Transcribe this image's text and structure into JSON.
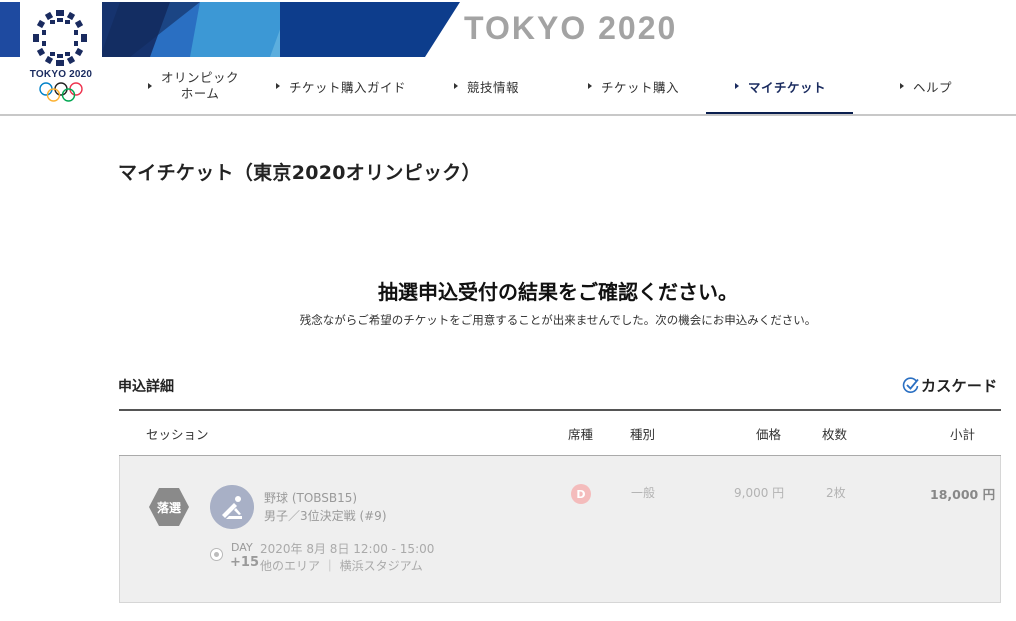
{
  "header": {
    "logo_text": "TOKYO 2020",
    "brand_text": "TOKYO 2020",
    "nav": [
      {
        "label_line1": "オリンピック",
        "label_line2": "ホーム"
      },
      {
        "label": "チケット購入ガイド"
      },
      {
        "label": "競技情報"
      },
      {
        "label": "チケット購入"
      },
      {
        "label": "マイチケット",
        "active": true
      },
      {
        "label": "ヘルプ"
      }
    ]
  },
  "page": {
    "title": "マイチケット（東京2020オリンピック）",
    "result_heading": "抽選申込受付の結果をご確認ください。",
    "result_sub": "残念ながらご希望のチケットをご用意することが出来ませんでした。次の機会にお申込みください。",
    "detail_label": "申込詳細",
    "cascade_label": "カスケード"
  },
  "table": {
    "headers": {
      "session": "セッション",
      "seat": "席種",
      "type": "種別",
      "price": "価格",
      "qty": "枚数",
      "subtotal": "小計"
    },
    "rows": [
      {
        "status": "落選",
        "event": "野球 (TOBSB15)",
        "event_sub": "男子／3位決定戦 (#9)",
        "day_label": "DAY",
        "day_num": "+15",
        "datetime": "2020年 8月 8日 12:00 - 15:00",
        "venue": "他のエリア ｜ 横浜スタジアム",
        "seat": "D",
        "type": "一般",
        "price": "9,000 円",
        "qty": "2枚",
        "subtotal": "18,000 円"
      }
    ]
  },
  "colors": {
    "navy": "#1a2b5f",
    "brand_gray": "#a3a3a3",
    "badge_gray": "#8a8a8a",
    "seat_pink": "#f4bcbc"
  },
  "icons": {
    "emblem": "tokyo-2020-emblem-icon",
    "rings": "olympic-rings-icon",
    "cascade": "check-icon",
    "sport": "baseball-pictogram-icon"
  }
}
